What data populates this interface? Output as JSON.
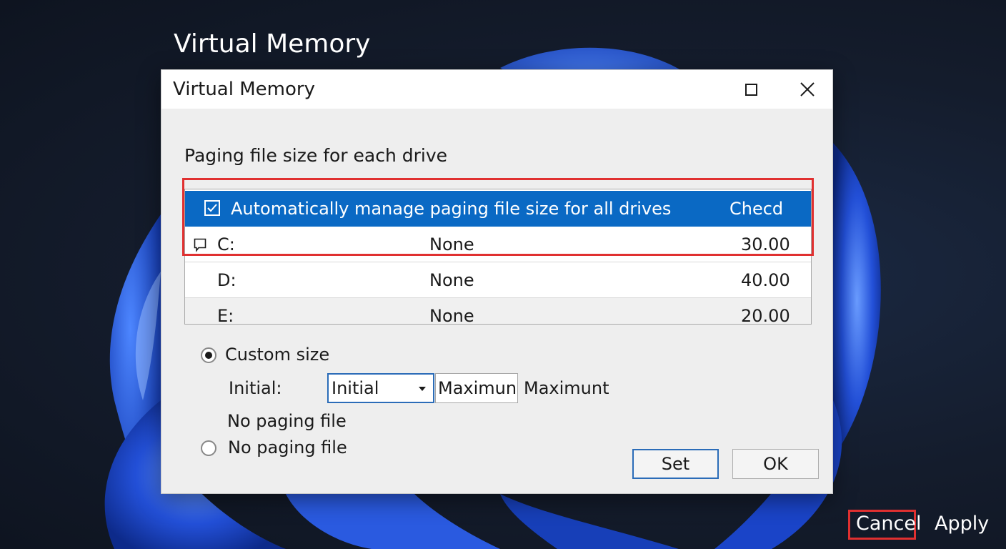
{
  "background": {
    "title": "Virtual Memory"
  },
  "dialog": {
    "title": "Virtual Memory",
    "section_label": "Paging file size for each drive",
    "rows": [
      {
        "text": "Automatically manage paging file size for all drives",
        "value": "Checd"
      },
      {
        "drive": "C:",
        "status": "None",
        "value": "30.00"
      },
      {
        "drive": "D:",
        "status": "None",
        "value": "40.00"
      },
      {
        "drive": "E:",
        "status": "None",
        "value": "20.00"
      }
    ],
    "custom_size_label": "Custom size",
    "initial_label": "Initial:",
    "initial_select_value": "Initial",
    "maximum_field_value": "Maximun",
    "maximum_label": "Maximunt",
    "no_paging_note": "No paging file",
    "no_paging_radio_label": "No paging file",
    "set_label": "Set",
    "ok_label": "OK"
  },
  "footer": {
    "cancel_label": "Cancel",
    "apply_label": "Apply"
  },
  "colors": {
    "selection": "#0a69c4",
    "highlight": "#e03030",
    "accent_border": "#2b6cb8",
    "wallpaper_bloom": "#2350d8"
  },
  "icons": {
    "maximize": "maximize-icon",
    "close": "close-icon",
    "checkbox": "checkbox-checked-icon",
    "row_marker": "comment-icon",
    "dropdown": "chevron-down-icon"
  }
}
